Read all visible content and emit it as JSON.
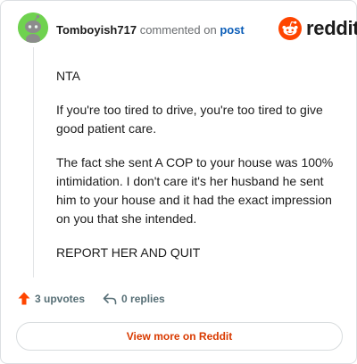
{
  "header": {
    "username": "Tomboyish717",
    "action_text": "commented on",
    "post_link": "post",
    "brand": "reddit"
  },
  "comment": {
    "paragraphs": [
      "NTA",
      "If you're too tired to drive, you're too tired to give good patient care.",
      "The fact she sent A COP to your house was 100% intimidation. I don't care it's her husband he sent him to your house and it had the exact impression on you that she intended.",
      "REPORT HER AND QUIT"
    ]
  },
  "footer": {
    "upvotes": "3 upvotes",
    "replies": "0 replies",
    "view_more": "View more on Reddit"
  },
  "colors": {
    "reddit_orange": "#ff4500",
    "link_blue": "#0b5db8",
    "avatar_green": "#6fd24f",
    "view_more_text": "#d93a00"
  },
  "icons": {
    "avatar": "snoo-avatar-icon",
    "brand": "reddit-snoo-icon",
    "upvote": "upvote-arrow-icon",
    "reply": "reply-arrow-icon"
  }
}
